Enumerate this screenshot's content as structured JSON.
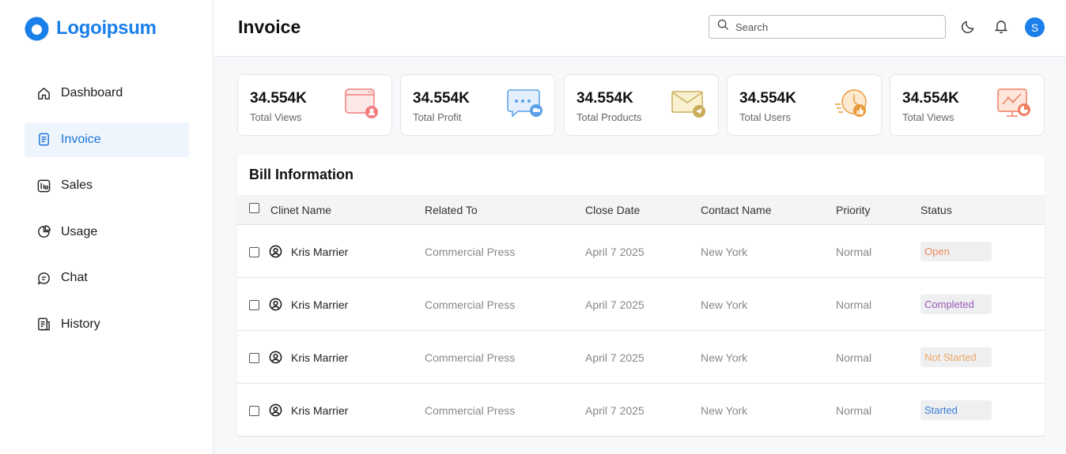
{
  "brand": {
    "name": "Logoipsum",
    "color": "#1a7fe8"
  },
  "sidebar": {
    "items": [
      {
        "label": "Dashboard",
        "icon": "home-icon"
      },
      {
        "label": "Invoice",
        "icon": "document-icon"
      },
      {
        "label": "Sales",
        "icon": "sales-icon"
      },
      {
        "label": "Usage",
        "icon": "pie-chart-icon"
      },
      {
        "label": "Chat",
        "icon": "chat-icon"
      },
      {
        "label": "History",
        "icon": "history-icon"
      }
    ],
    "active": "Invoice"
  },
  "header": {
    "title": "Invoice",
    "search_placeholder": "Search",
    "avatar_initial": "S"
  },
  "stats": [
    {
      "value": "34.554K",
      "label": "Total Views",
      "icon": "browser-user-icon"
    },
    {
      "value": "34.554K",
      "label": "Total Profit",
      "icon": "chat-bubble-icon"
    },
    {
      "value": "34.554K",
      "label": "Total Products",
      "icon": "mail-send-icon"
    },
    {
      "value": "34.554K",
      "label": "Total Users",
      "icon": "clock-like-icon"
    },
    {
      "value": "34.554K",
      "label": "Total Views",
      "icon": "analytics-screen-icon"
    }
  ],
  "bill": {
    "title": "Bill Information",
    "columns": [
      "Clinet Name",
      "Related To",
      "Close Date",
      "Contact Name",
      "Priority",
      "Status"
    ],
    "rows": [
      {
        "name": "Kris Marrier",
        "related": "Commercial Press",
        "date": "April 7 2025",
        "contact": "New York",
        "priority": "Normal",
        "status": "Open",
        "status_color": "#f08a5d"
      },
      {
        "name": "Kris Marrier",
        "related": "Commercial Press",
        "date": "April 7 2025",
        "contact": "New York",
        "priority": "Normal",
        "status": "Completed",
        "status_color": "#9b59b6"
      },
      {
        "name": "Kris Marrier",
        "related": "Commercial Press",
        "date": "April 7 2025",
        "contact": "New York",
        "priority": "Normal",
        "status": "Not Started",
        "status_color": "#f0a868"
      },
      {
        "name": "Kris Marrier",
        "related": "Commercial Press",
        "date": "April 7 2025",
        "contact": "New York",
        "priority": "Normal",
        "status": "Started",
        "status_color": "#3b7dd8"
      }
    ]
  }
}
